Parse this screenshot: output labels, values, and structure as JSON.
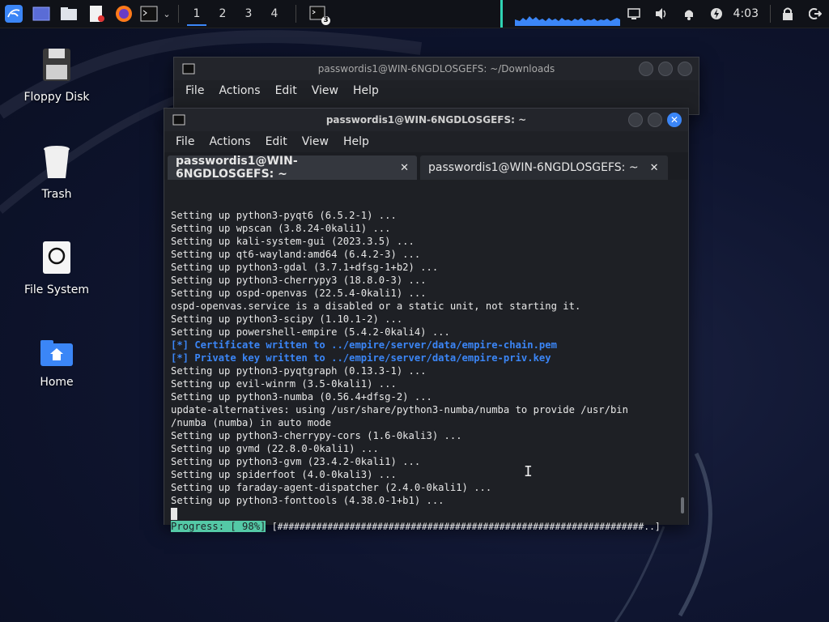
{
  "panel": {
    "workspaces": [
      "1",
      "2",
      "3",
      "4"
    ],
    "clock": "4:03",
    "terminal_badge": "3"
  },
  "desktop": {
    "icons": [
      {
        "label": "Floppy Disk"
      },
      {
        "label": "Trash"
      },
      {
        "label": "File System"
      },
      {
        "label": "Home"
      }
    ]
  },
  "back_window": {
    "title": "passwordis1@WIN-6NGDLOSGEFS: ~/Downloads",
    "menu": [
      "File",
      "Actions",
      "Edit",
      "View",
      "Help"
    ]
  },
  "front_window": {
    "title": "passwordis1@WIN-6NGDLOSGEFS: ~",
    "menu": [
      "File",
      "Actions",
      "Edit",
      "View",
      "Help"
    ],
    "tabs": [
      {
        "label": "passwordis1@WIN-6NGDLOSGEFS: ~",
        "close": "✕"
      },
      {
        "label": "passwordis1@WIN-6NGDLOSGEFS: ~",
        "close": "✕"
      }
    ],
    "lines": [
      "Setting up python3-pyqt6 (6.5.2-1) ...",
      "Setting up wpscan (3.8.24-0kali1) ...",
      "Setting up kali-system-gui (2023.3.5) ...",
      "Setting up qt6-wayland:amd64 (6.4.2-3) ...",
      "Setting up python3-gdal (3.7.1+dfsg-1+b2) ...",
      "Setting up python3-cherrypy3 (18.8.0-3) ...",
      "Setting up ospd-openvas (22.5.4-0kali1) ...",
      "ospd-openvas.service is a disabled or a static unit, not starting it.",
      "Setting up python3-scipy (1.10.1-2) ...",
      "Setting up powershell-empire (5.4.2-0kali4) ...",
      "[*] Certificate written to ../empire/server/data/empire-chain.pem",
      "[*] Private key written to ../empire/server/data/empire-priv.key",
      "Setting up python3-pyqtgraph (0.13.3-1) ...",
      "Setting up evil-winrm (3.5-0kali1) ...",
      "Setting up python3-numba (0.56.4+dfsg-2) ...",
      "update-alternatives: using /usr/share/python3-numba/numba to provide /usr/bin",
      "/numba (numba) in auto mode",
      "Setting up python3-cherrypy-cors (1.6-0kali3) ...",
      "Setting up gvmd (22.8.0-0kali1) ...",
      "Setting up python3-gvm (23.4.2-0kali1) ...",
      "Setting up spiderfoot (4.0-0kali3) ...",
      "Setting up faraday-agent-dispatcher (2.4.0-0kali1) ...",
      "Setting up python3-fonttools (4.38.0-1+b1) ..."
    ],
    "highlight_indices": [
      10,
      11
    ],
    "progress_label": "Progress: [ 98%]",
    "progress_bar": "[##################################################################..]",
    "progress": 0.98
  },
  "colors": {
    "accent": "#3b86f7",
    "progress": "#54c9a6"
  }
}
